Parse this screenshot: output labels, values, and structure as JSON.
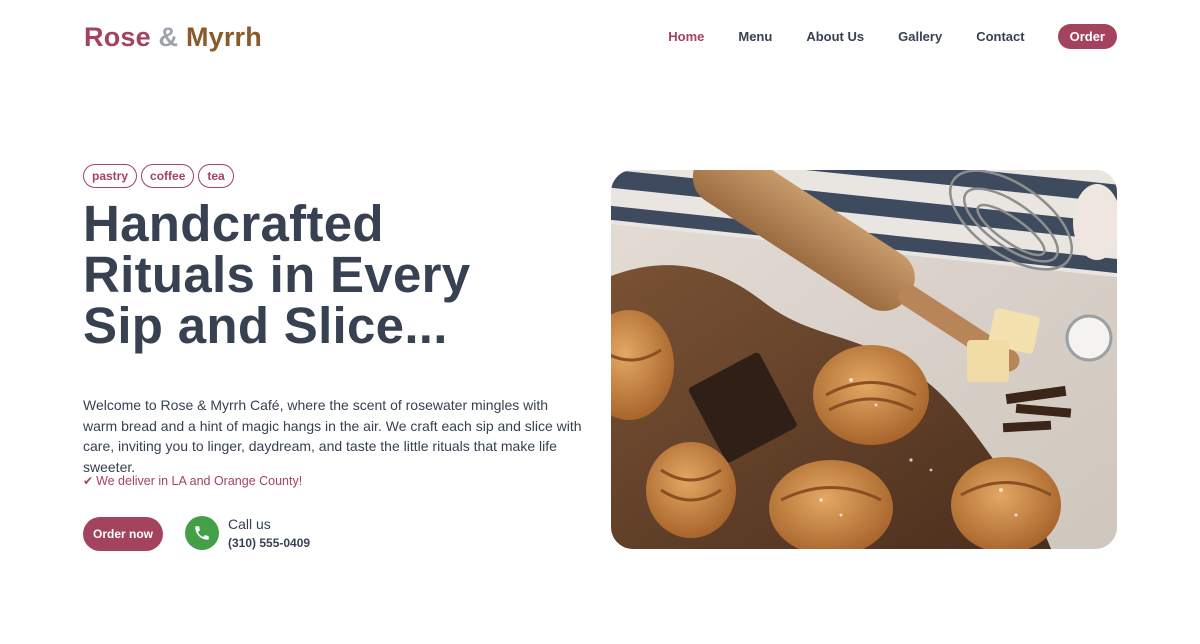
{
  "brand": {
    "part1": "Rose",
    "amp": "&",
    "part2": "Myrrh"
  },
  "nav": {
    "items": [
      {
        "label": "Home"
      },
      {
        "label": "Menu"
      },
      {
        "label": "About Us"
      },
      {
        "label": "Gallery"
      },
      {
        "label": "Contact"
      }
    ],
    "order_label": "Order"
  },
  "hero": {
    "tags": [
      "pastry",
      "coffee",
      "tea"
    ],
    "headline_lines": [
      "Handcrafted",
      "Rituals in Every",
      "Sip and Slice..."
    ],
    "intro": "Welcome to Rose & Myrrh Café, where the scent of rosewater mingles with warm bread and a hint of magic hangs in the air. We craft each sip and slice with care, inviting you to linger, daydream, and taste the little rituals that make life sweeter.",
    "delivery_check": "✔",
    "delivery_text": "We deliver in LA and Orange County!",
    "cta_label": "Order now",
    "call_label": "Call us",
    "phone": "(310) 555-0409"
  },
  "colors": {
    "accent": "#a3435e",
    "brand_second": "#8b5a2b",
    "text": "#374151",
    "phone_green": "#43a047"
  },
  "icons": {
    "phone": "phone-icon",
    "check": "check-icon"
  }
}
